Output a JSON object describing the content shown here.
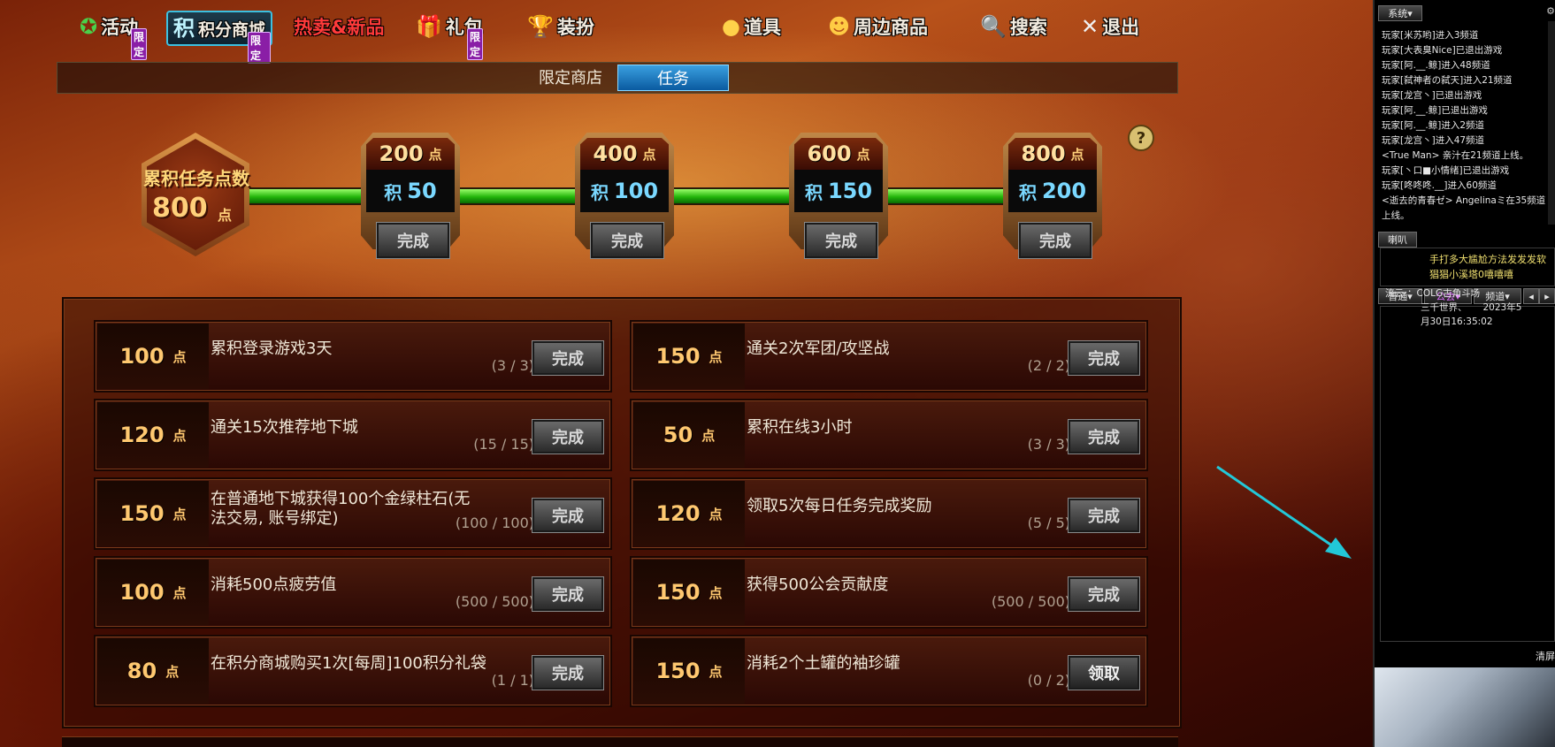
{
  "nav": {
    "activity": {
      "label": "活动",
      "badge": "限定"
    },
    "points_mall": {
      "icon_text": "积",
      "label": "积分商城",
      "badge": "限定"
    },
    "hot_new": {
      "label": "热卖&新品"
    },
    "gift": {
      "label": "礼包",
      "badge": "限定"
    },
    "costume": {
      "label": "装扮"
    },
    "items": {
      "label": "道具"
    },
    "merch": {
      "label": "周边商品"
    },
    "search": {
      "label": "搜索"
    },
    "exit": {
      "label": "退出"
    }
  },
  "subtabs": {
    "limited_shop": "限定商店",
    "tasks": "任务"
  },
  "progress": {
    "total_label": "累积任务点数",
    "total_value": "800",
    "unit": "点",
    "help": "?",
    "milestones": [
      {
        "points": "200",
        "reward_prefix": "积",
        "reward": "50",
        "button": "完成"
      },
      {
        "points": "400",
        "reward_prefix": "积",
        "reward": "100",
        "button": "完成"
      },
      {
        "points": "600",
        "reward_prefix": "积",
        "reward": "150",
        "button": "完成"
      },
      {
        "points": "800",
        "reward_prefix": "积",
        "reward": "200",
        "button": "完成"
      }
    ]
  },
  "tasks": [
    {
      "points": "100",
      "desc": "累积登录游戏3天",
      "progress": "(3 / 3)",
      "button": "完成"
    },
    {
      "points": "150",
      "desc": "通关2次军团/攻坚战",
      "progress": "(2 / 2)",
      "button": "完成"
    },
    {
      "points": "120",
      "desc": "通关15次推荐地下城",
      "progress": "(15 / 15)",
      "button": "完成"
    },
    {
      "points": "50",
      "desc": "累积在线3小时",
      "progress": "(3 / 3)",
      "button": "完成"
    },
    {
      "points": "150",
      "desc": "在普通地下城获得100个金绿柱石(无法交易, 账号绑定)",
      "progress": "(100 / 100)",
      "button": "完成"
    },
    {
      "points": "120",
      "desc": "领取5次每日任务完成奖励",
      "progress": "(5 / 5)",
      "button": "完成"
    },
    {
      "points": "100",
      "desc": "消耗500点疲劳值",
      "progress": "(500 / 500)",
      "button": "完成"
    },
    {
      "points": "150",
      "desc": "获得500公会贡献度",
      "progress": "(500 / 500)",
      "button": "完成"
    },
    {
      "points": "80",
      "desc": "在积分商城购买1次[每周]100积分礼袋",
      "progress": "(1 / 1)",
      "button": "完成"
    },
    {
      "points": "150",
      "desc": "消耗2个土罐的袖珍罐",
      "progress": "(0 / 2)",
      "button": "领取"
    }
  ],
  "chat": {
    "system_tab": "系统",
    "system_log": [
      "玩家[米苏哟]进入3频道",
      "玩家[大表臭Nice]已退出游戏",
      "玩家[阿.__.鲸]进入48频道",
      "玩家[弑神者の弑天]进入21频道",
      "玩家[龙宫丶]已退出游戏",
      "玩家[阿.__.鲸]已退出游戏",
      "玩家[阿.__.鲸]进入2频道",
      "玩家[龙宫丶]进入47频道",
      "<True Man> 亲汁在21频道上线。",
      "玩家[丶口■小情绪]已退出游戏",
      "玩家[咚咚咚.__]进入60频道",
      "<逝去的青春ゼ> Angelinaミ在35频道上线。"
    ],
    "horn_tab": "喇叭",
    "horn_text": "手打多大尴尬方法发发发软猖猖小溪塔0嘻嘻嘻",
    "tab_normal": "普通",
    "tab_guild": "公会",
    "tab_channel": "频道",
    "message": {
      "sender": "流云",
      "text": "：COLG古角斗场",
      "line2": "三千世界、",
      "line2b": "2023年5",
      "line3": "月30日16:35:02"
    },
    "clear": "清屏"
  }
}
